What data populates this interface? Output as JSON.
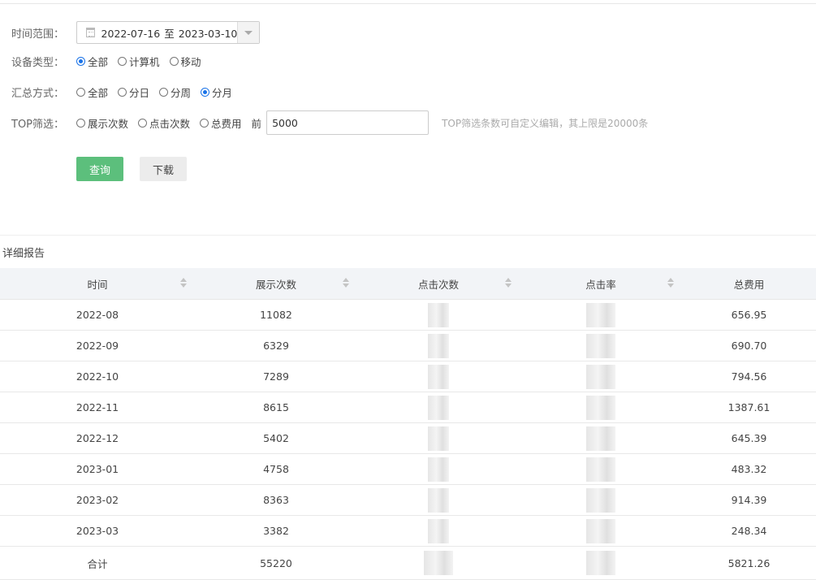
{
  "filters": {
    "time_range": {
      "label": "时间范围：",
      "start": "2022-07-16",
      "separator": "至",
      "end": "2023-03-10"
    },
    "device_type": {
      "label": "设备类型：",
      "options": [
        "全部",
        "计算机",
        "移动"
      ],
      "selected": "全部"
    },
    "summary_mode": {
      "label": "汇总方式：",
      "options": [
        "全部",
        "分日",
        "分周",
        "分月"
      ],
      "selected": "分月"
    },
    "top_filter": {
      "label": "TOP筛选：",
      "options": [
        "展示次数",
        "点击次数",
        "总费用"
      ],
      "selected": "",
      "prefix": "前",
      "value": "5000",
      "hint": "TOP筛选条数可自定义编辑，其上限是20000条"
    }
  },
  "buttons": {
    "query": "查询",
    "download": "下载"
  },
  "report": {
    "title": "详细报告",
    "columns": [
      "时间",
      "展示次数",
      "点击次数",
      "点击率",
      "总费用"
    ],
    "rows": [
      {
        "time": "2022-08",
        "impressions": "11082",
        "cost": "656.95"
      },
      {
        "time": "2022-09",
        "impressions": "6329",
        "cost": "690.70"
      },
      {
        "time": "2022-10",
        "impressions": "7289",
        "cost": "794.56"
      },
      {
        "time": "2022-11",
        "impressions": "8615",
        "cost": "1387.61"
      },
      {
        "time": "2022-12",
        "impressions": "5402",
        "cost": "645.39"
      },
      {
        "time": "2023-01",
        "impressions": "4758",
        "cost": "483.32"
      },
      {
        "time": "2023-02",
        "impressions": "8363",
        "cost": "914.39"
      },
      {
        "time": "2023-03",
        "impressions": "3382",
        "cost": "248.34"
      }
    ],
    "total": {
      "label": "合计",
      "impressions": "55220",
      "cost": "5821.26"
    }
  }
}
